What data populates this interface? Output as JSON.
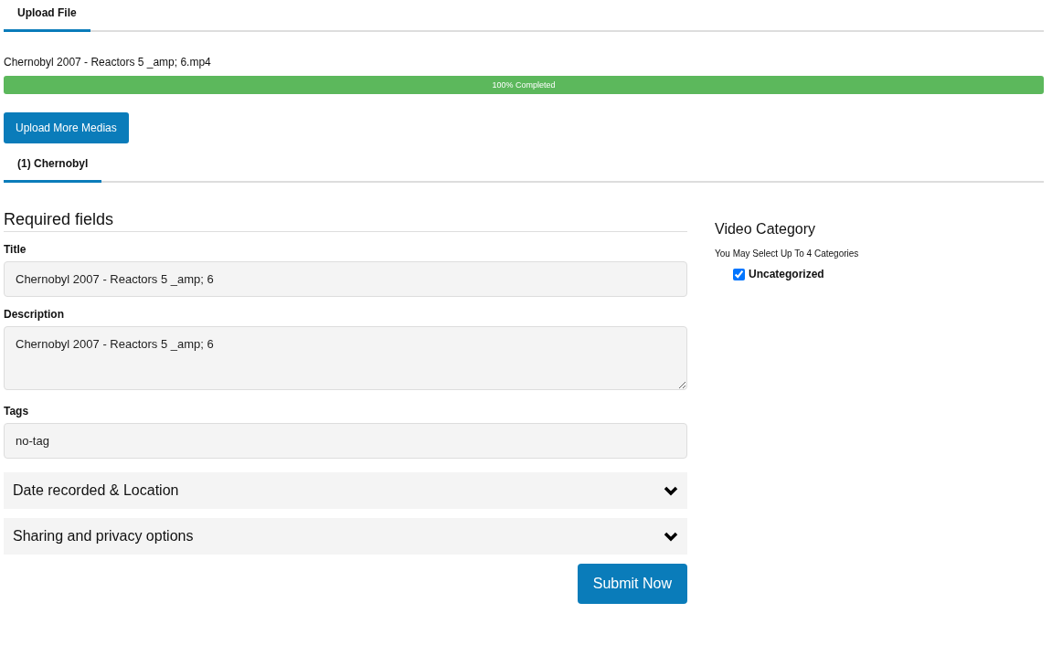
{
  "upload_tabs": [
    {
      "label": "Upload File",
      "selected": true
    }
  ],
  "file": {
    "name": "Chernobyl 2007 - Reactors 5 _amp; 6.mp4",
    "progress_label": "100% Completed",
    "level": 1
  },
  "upload_more_button": "Upload More Medias",
  "media_tabs": [
    {
      "label": "(1) Chernobyl",
      "selected": true
    }
  ],
  "form": {
    "heading": "Required fields",
    "fields": [
      {
        "kind": "input",
        "label": "Title",
        "value": "Chernobyl 2007 - Reactors 5 _amp; 6"
      },
      {
        "kind": "textarea",
        "label": "Description",
        "value": "Chernobyl 2007 - Reactors 5 _amp; 6"
      },
      {
        "kind": "input",
        "label": "Tags",
        "value": "no-tag"
      }
    ],
    "sections": [
      {
        "label": "Date recorded & Location",
        "expanded": false
      },
      {
        "label": "Sharing and privacy options",
        "expanded": false
      }
    ],
    "submit": "Submit Now"
  },
  "category": {
    "title": "Video Category",
    "hint": "You May Select Up To 4 Categories",
    "options": [
      {
        "label": "Uncategorized",
        "checked": true
      }
    ]
  }
}
